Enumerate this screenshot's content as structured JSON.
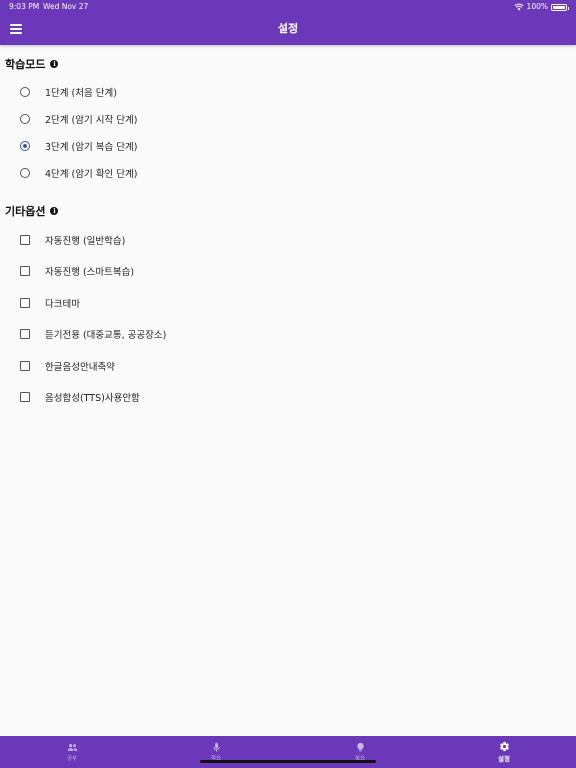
{
  "status_bar": {
    "time": "9:03 PM",
    "date": "Wed Nov 27",
    "battery": "100%",
    "battery_level": 1.0
  },
  "header": {
    "title": "설정",
    "menu_icon": "hamburger-menu-icon"
  },
  "learning_mode": {
    "title": "학습모드",
    "info_icon": "info-icon",
    "options": [
      {
        "label": "1단계 (처음 단계)",
        "selected": false
      },
      {
        "label": "2단계 (암기 시작 단계)",
        "selected": false
      },
      {
        "label": "3단계 (암기 복습 단계)",
        "selected": true
      },
      {
        "label": "4단계 (암기 확인 단계)",
        "selected": false
      }
    ]
  },
  "other_options": {
    "title": "기타옵션",
    "info_icon": "info-icon",
    "options": [
      {
        "label": "자동진행 (일반학습)",
        "checked": false
      },
      {
        "label": "자동진행 (스마트복습)",
        "checked": false
      },
      {
        "label": "다크테마",
        "checked": false
      },
      {
        "label": "듣기전용 (대중교통, 공공장소)",
        "checked": false
      },
      {
        "label": "한글음성안내축약",
        "checked": false
      },
      {
        "label": "음성합성(TTS)사용안함",
        "checked": false
      }
    ]
  },
  "tabs": [
    {
      "label": "공부",
      "icon": "people-icon",
      "active": false
    },
    {
      "label": "학습",
      "icon": "microphone-icon",
      "active": false
    },
    {
      "label": "복습",
      "icon": "lightbulb-icon",
      "active": false
    },
    {
      "label": "설정",
      "icon": "gear-icon",
      "active": true
    }
  ],
  "colors": {
    "primary": "#6a38b9",
    "accent": "#3f51b5",
    "background": "#fafafa"
  }
}
